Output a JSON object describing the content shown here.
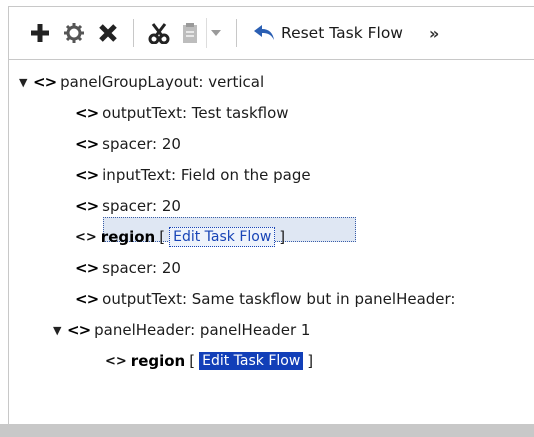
{
  "toolbar": {
    "reset_label": "Reset Task Flow",
    "overflow_label": "»"
  },
  "tree": {
    "root": {
      "text": "panelGroupLayout: vertical"
    },
    "items": [
      {
        "text": "outputText: Test taskflow"
      },
      {
        "text": "spacer: 20"
      },
      {
        "text": "inputText: Field on the page"
      },
      {
        "text": "spacer: 20"
      }
    ],
    "region1": {
      "label": "region",
      "open": "[",
      "link": "Edit Task Flow",
      "close": "]"
    },
    "items2": [
      {
        "text": "spacer: 20"
      },
      {
        "text": "outputText: Same taskflow but in panelHeader:"
      }
    ],
    "panelHeader": {
      "text": "panelHeader: panelHeader 1"
    },
    "region2": {
      "label": "region",
      "open": "[",
      "link": "Edit Task Flow",
      "close": "]"
    }
  },
  "colors": {
    "selection_bg": "#dfe7f3",
    "link_highlight_bg": "#123fb8",
    "link_text": "#1844b6",
    "reset_icon": "#2b5fb3"
  }
}
